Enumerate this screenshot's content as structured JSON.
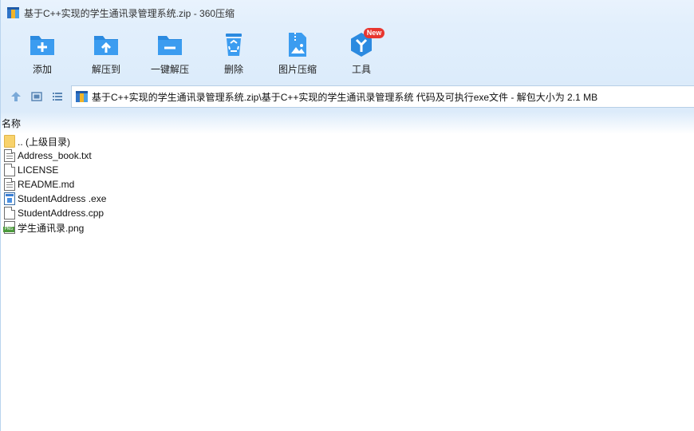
{
  "window": {
    "title": "基于C++实现的学生通讯录管理系统.zip - 360压缩"
  },
  "toolbar": {
    "items": [
      {
        "label": "添加",
        "icon": "add-icon"
      },
      {
        "label": "解压到",
        "icon": "extract-to-icon"
      },
      {
        "label": "一键解压",
        "icon": "one-click-extract-icon"
      },
      {
        "label": "删除",
        "icon": "delete-icon"
      },
      {
        "label": "图片压缩",
        "icon": "image-compress-icon"
      },
      {
        "label": "工具",
        "icon": "tools-icon",
        "badge": "New"
      }
    ]
  },
  "address": {
    "path": "基于C++实现的学生通讯录管理系统.zip\\基于C++实现的学生通讯录管理系统 代码及可执行exe文件 - 解包大小为 2.1 MB"
  },
  "list": {
    "column_name": "名称",
    "files": [
      {
        "name": ".. (上级目录)",
        "type": "folder"
      },
      {
        "name": "Address_book.txt",
        "type": "text"
      },
      {
        "name": "LICENSE",
        "type": "file"
      },
      {
        "name": "README.md",
        "type": "text"
      },
      {
        "name": "StudentAddress .exe",
        "type": "exe"
      },
      {
        "name": "StudentAddress.cpp",
        "type": "file"
      },
      {
        "name": "学生通讯录.png",
        "type": "png"
      }
    ]
  },
  "colors": {
    "accent": "#2b8ae0",
    "toolbar_bg": "#dcecfb",
    "badge": "#e8362f"
  }
}
